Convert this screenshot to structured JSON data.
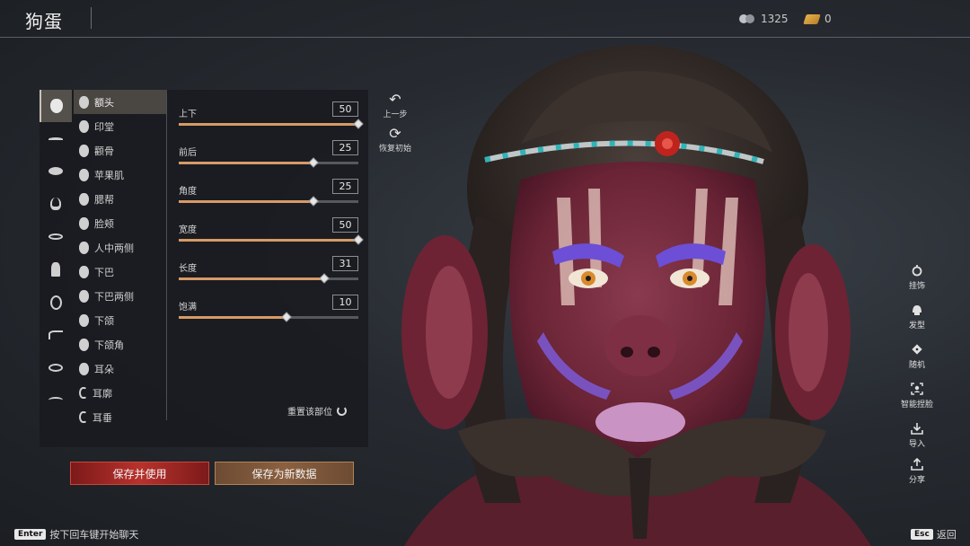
{
  "header": {
    "title": "狗蛋"
  },
  "currency": [
    {
      "icon": "silver-coins-icon",
      "value": "1325"
    },
    {
      "icon": "gold-bar-icon",
      "value": "0"
    }
  ],
  "categories": [
    {
      "icon": "face-icon",
      "active": true
    },
    {
      "icon": "eyebrow-icon"
    },
    {
      "icon": "eye-icon"
    },
    {
      "icon": "nose-icon"
    },
    {
      "icon": "mouth-icon"
    },
    {
      "icon": "body-icon"
    },
    {
      "icon": "head-icon"
    },
    {
      "icon": "jaw-icon"
    },
    {
      "icon": "ear-icon"
    },
    {
      "icon": "cheek-icon"
    }
  ],
  "parts": [
    {
      "label": "额头",
      "active": true
    },
    {
      "label": "印堂"
    },
    {
      "label": "颧骨"
    },
    {
      "label": "苹果肌"
    },
    {
      "label": "腮帮"
    },
    {
      "label": "脸颊"
    },
    {
      "label": "人中两侧"
    },
    {
      "label": "下巴"
    },
    {
      "label": "下巴两侧"
    },
    {
      "label": "下颌"
    },
    {
      "label": "下颌角"
    },
    {
      "label": "耳朵"
    },
    {
      "label": "耳廓"
    },
    {
      "label": "耳垂"
    }
  ],
  "sliders": [
    {
      "label": "上下",
      "value": "50",
      "fraction": 1.0
    },
    {
      "label": "前后",
      "value": "25",
      "fraction": 0.75
    },
    {
      "label": "角度",
      "value": "25",
      "fraction": 0.75
    },
    {
      "label": "宽度",
      "value": "50",
      "fraction": 1.0
    },
    {
      "label": "长度",
      "value": "31",
      "fraction": 0.81
    },
    {
      "label": "饱满",
      "value": "10",
      "fraction": 0.6
    }
  ],
  "reset_part_label": "重置该部位",
  "undo_label": "上一步",
  "restore_label": "恢复初始",
  "buttons": {
    "save_use": "保存并使用",
    "save_new": "保存为新数据"
  },
  "right_toolbar": [
    {
      "icon": "accessory-icon",
      "label": "挂饰"
    },
    {
      "icon": "hairstyle-icon",
      "label": "发型"
    },
    {
      "icon": "dice-icon",
      "label": "随机"
    },
    {
      "icon": "smart-face-icon",
      "label": "智能捏脸"
    },
    {
      "icon": "import-icon",
      "label": "导入"
    },
    {
      "icon": "share-icon",
      "label": "分享"
    }
  ],
  "footer": {
    "enter_key": "Enter",
    "enter_hint": "按下回车键开始聊天",
    "esc_key": "Esc",
    "esc_hint": "返回"
  },
  "colors": {
    "accent_slider": "#d79a66",
    "save_use_red": "#b8322c",
    "save_new_brown": "#8a6040"
  }
}
